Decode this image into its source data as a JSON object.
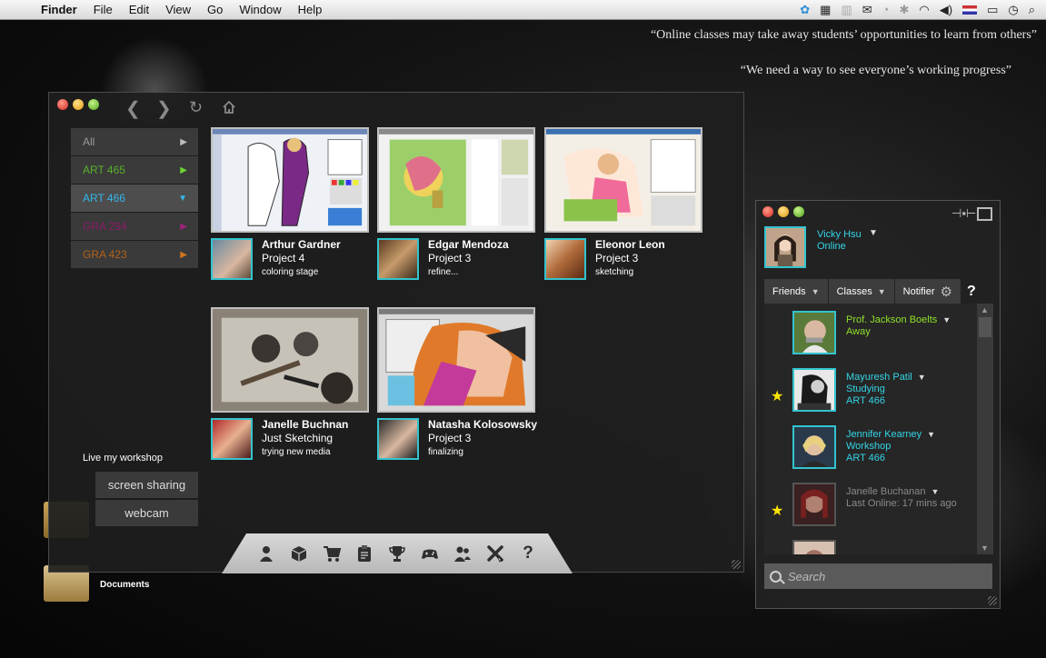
{
  "menubar": {
    "app_name": "Finder",
    "items": [
      "File",
      "Edit",
      "View",
      "Go",
      "Window",
      "Help"
    ]
  },
  "quotes": [
    "“Online classes may take away students’ opportunities to learn from others”",
    "“We need a way to see everyone’s working progress”"
  ],
  "desktop": {
    "documents_label": "Documents"
  },
  "main_window": {
    "classes": [
      {
        "label": "All",
        "color": "#9a9a9a",
        "arrow_color": "#bdbdbd",
        "arrow": "▶"
      },
      {
        "label": "ART 465",
        "color": "#59b12b",
        "arrow_color": "#6ed233",
        "arrow": "▶"
      },
      {
        "label": "ART 466",
        "color": "#33b6ea",
        "arrow_color": "#33b6ea",
        "arrow": "▼"
      },
      {
        "label": "GRA 294",
        "color": "#8c1c68",
        "arrow_color": "#9c237a",
        "arrow": "▶"
      },
      {
        "label": "GRA 423",
        "color": "#b3621b",
        "arrow_color": "#d07420",
        "arrow": "▶"
      }
    ],
    "students": [
      {
        "name": "Arthur Gardner",
        "project": "Project 4",
        "status": "coloring stage"
      },
      {
        "name": "Edgar Mendoza",
        "project": "Project 3",
        "status": "refine..."
      },
      {
        "name": "Eleonor Leon",
        "project": "Project 3",
        "status": "sketching"
      },
      {
        "name": "Janelle Buchnan",
        "project": "Just Sketching",
        "status": "trying new media"
      },
      {
        "name": "Natasha Kolosowsky",
        "project": "Project 3",
        "status": "finalizing"
      }
    ],
    "workshop": {
      "label": "Live my workshop",
      "screen_sharing": "screen sharing",
      "webcam": "webcam"
    },
    "toolbar_icons": [
      "person-icon",
      "box-icon",
      "cart-icon",
      "clipboard-icon",
      "trophy-icon",
      "gamepad-icon",
      "people-icon",
      "tools-icon",
      "help-icon"
    ]
  },
  "friends_window": {
    "me": {
      "name": "Vicky Hsu",
      "status": "Online"
    },
    "tabs": {
      "friends": "Friends",
      "classes": "Classes",
      "notifier": "Notifier",
      "help": "?"
    },
    "friends": [
      {
        "name": "Prof. Jackson Boelts",
        "line2": "Away",
        "line3": "",
        "starred": false,
        "color": "#8fe02b"
      },
      {
        "name": "Mayuresh Patil",
        "line2": "Studying",
        "line3": "ART 466",
        "starred": true,
        "color": "#33d4e6"
      },
      {
        "name": "Jennifer Kearney",
        "line2": "Workshop",
        "line3": "ART 466",
        "starred": false,
        "color": "#33d4e6"
      },
      {
        "name": "Janelle Buchanan",
        "line2": "Last Online: 17 mins ago",
        "line3": "",
        "starred": true,
        "color": "#8a8a8a"
      }
    ],
    "search": {
      "placeholder": "Search"
    }
  }
}
